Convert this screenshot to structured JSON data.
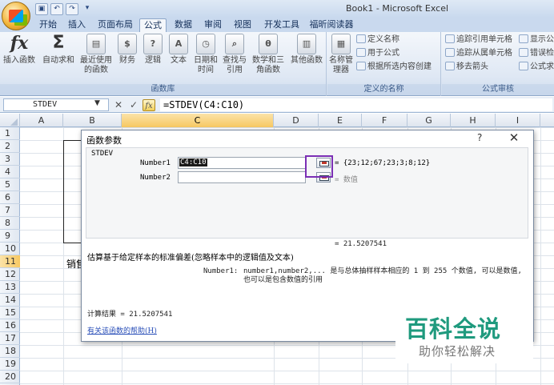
{
  "window": {
    "title": "Book1 - Microsoft Excel"
  },
  "qat": {
    "save": "▣",
    "undo": "↶",
    "redo": "↷",
    "customize": "▾"
  },
  "tabs": [
    "开始",
    "插入",
    "页面布局",
    "公式",
    "数据",
    "审阅",
    "视图",
    "开发工具",
    "福昕阅读器"
  ],
  "ribbon": {
    "function_library": {
      "label": "函数库",
      "buttons": [
        {
          "label": "插入函数",
          "icon": "fx-icon"
        },
        {
          "label": "自动求和",
          "icon": "sigma-icon"
        },
        {
          "label": "最近使用的函数",
          "icon": "book-icon"
        },
        {
          "label": "财务",
          "icon": "book-icon"
        },
        {
          "label": "逻辑",
          "icon": "book-icon"
        },
        {
          "label": "文本",
          "icon": "book-icon"
        },
        {
          "label": "日期和时间",
          "icon": "book-icon"
        },
        {
          "label": "查找与引用",
          "icon": "book-icon"
        },
        {
          "label": "数学和三角函数",
          "icon": "book-icon"
        },
        {
          "label": "其他函数",
          "icon": "book-icon"
        }
      ]
    },
    "defined_names": {
      "label": "定义的名称",
      "manager": "名称管理器",
      "define": "定义名称",
      "use_in_formula": "用于公式",
      "create_from_selection": "根据所选内容创建"
    },
    "formula_auditing": {
      "label": "公式审核",
      "trace_precedents": "追踪引用单元格",
      "trace_dependents": "追踪从属单元格",
      "remove_arrows": "移去箭头",
      "show_formulas": "显示公",
      "error_checking": "错误检",
      "evaluate": "公式求"
    }
  },
  "formula_bar": {
    "name_box": "STDEV",
    "formula": "=STDEV(C4:C10)"
  },
  "columns": [
    "A",
    "B",
    "C",
    "D",
    "E",
    "F",
    "G",
    "H",
    "I"
  ],
  "selected_column": "C",
  "rows": [
    "1",
    "2",
    "3",
    "4",
    "5",
    "6",
    "7",
    "8",
    "9",
    "10",
    "11",
    "12",
    "13",
    "14",
    "15",
    "16",
    "17",
    "18",
    "19",
    "20"
  ],
  "selected_row": "11",
  "cells": {
    "B11": "销售"
  },
  "dialog": {
    "title": "函数参数",
    "help": "?",
    "close": "✕",
    "function_name": "STDEV",
    "args": [
      {
        "label": "Number1",
        "value": "C4:C10",
        "result": "= {23;12;67;23;3;8;12}"
      },
      {
        "label": "Number2",
        "value": "",
        "result": "= 数值"
      }
    ],
    "formula_result_line": "= 21.5207541",
    "description": "估算基于给定样本的标准偏差(忽略样本中的逻辑值及文本)",
    "arg_description_label": "Number1:",
    "arg_description": "number1,number2,... 是与总体抽样样本相应的 1 到 255 个数值, 可以是数值, 也可以是包含数值的引用",
    "calc_result": "计算结果 = 21.5207541",
    "help_link": "有关该函数的帮助(H)"
  },
  "watermark": {
    "main": "百科全说",
    "sub": "助你轻松解决"
  },
  "colors": {
    "accent": "#7b2fb5",
    "watermark": "#1f9a7e"
  }
}
